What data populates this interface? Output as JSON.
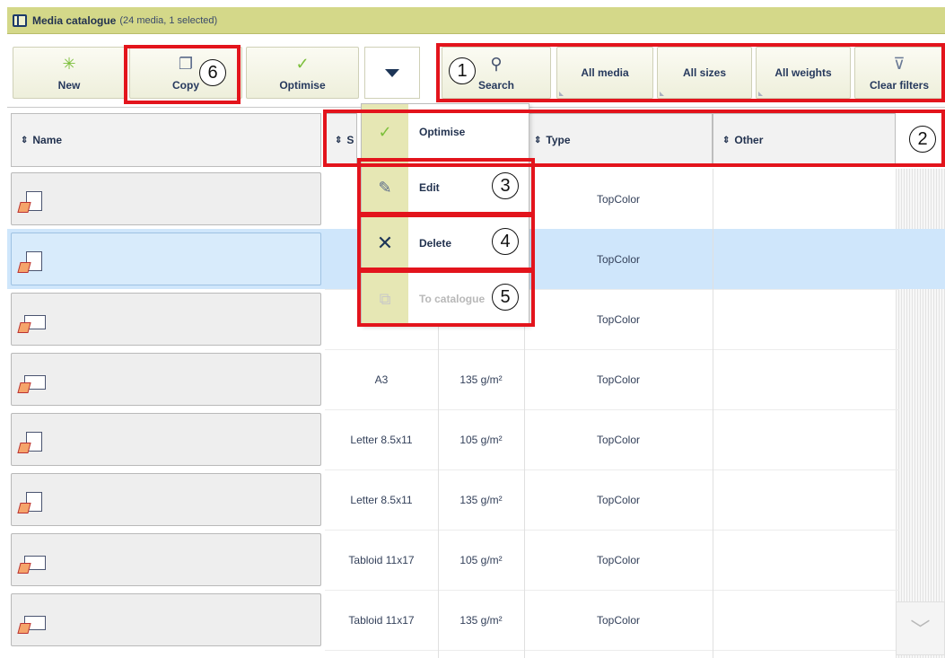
{
  "window": {
    "title": "Media catalogue",
    "subtitle": "(24 media, 1 selected)",
    "title_icon": "catalogue-icon"
  },
  "toolbar": {
    "buttons": [
      {
        "label": "New",
        "icon": "sparkle-icon"
      },
      {
        "label": "Copy",
        "icon": "copy-icon"
      },
      {
        "label": "Optimise",
        "icon": "optimise-icon"
      }
    ],
    "dropdown_icon": "triangle-down-icon",
    "filters": [
      {
        "label": "Search",
        "icon": "binoculars-icon"
      },
      {
        "label": "All media"
      },
      {
        "label": "All sizes"
      },
      {
        "label": "All weights"
      },
      {
        "label": "Clear filters",
        "icon": "clear-filter-icon"
      }
    ]
  },
  "table": {
    "columns": [
      {
        "label": "Name",
        "sort_icon": "sort-icon"
      },
      {
        "label": "S"
      },
      {
        "label": "Type"
      },
      {
        "label": "Other"
      }
    ],
    "rows": [
      {
        "size": "",
        "weight": "",
        "type": "TopColor",
        "other": "",
        "selected": false
      },
      {
        "size": "",
        "weight": "",
        "type": "TopColor",
        "other": "",
        "selected": true
      },
      {
        "size": "",
        "weight": "",
        "type": "TopColor",
        "other": "",
        "selected": false
      },
      {
        "size": "A3",
        "weight": "135 g/m²",
        "type": "TopColor",
        "other": "",
        "selected": false
      },
      {
        "size": "Letter 8.5x11",
        "weight": "105 g/m²",
        "type": "TopColor",
        "other": "",
        "selected": false
      },
      {
        "size": "Letter 8.5x11",
        "weight": "135 g/m²",
        "type": "TopColor",
        "other": "",
        "selected": false
      },
      {
        "size": "Tabloid 11x17",
        "weight": "105 g/m²",
        "type": "TopColor",
        "other": "",
        "selected": false
      },
      {
        "size": "Tabloid 11x17",
        "weight": "135 g/m²",
        "type": "TopColor",
        "other": "",
        "selected": false
      }
    ]
  },
  "menu": {
    "items": [
      {
        "label": "Optimise",
        "icon": "optimise-icon",
        "enabled": true
      },
      {
        "label": "Edit",
        "icon": "pencil-icon",
        "enabled": true
      },
      {
        "label": "Delete",
        "icon": "cross-icon",
        "enabled": true
      },
      {
        "label": "To catalogue",
        "icon": "to-catalogue-icon",
        "enabled": false
      }
    ]
  },
  "callouts": [
    "1",
    "2",
    "3",
    "4",
    "5",
    "6"
  ],
  "colors": {
    "title_bar": "#d4d889",
    "menu_strip": "#e6e7b4",
    "selected_row": "#cfe6fb",
    "callout_red": "#e3141c"
  }
}
